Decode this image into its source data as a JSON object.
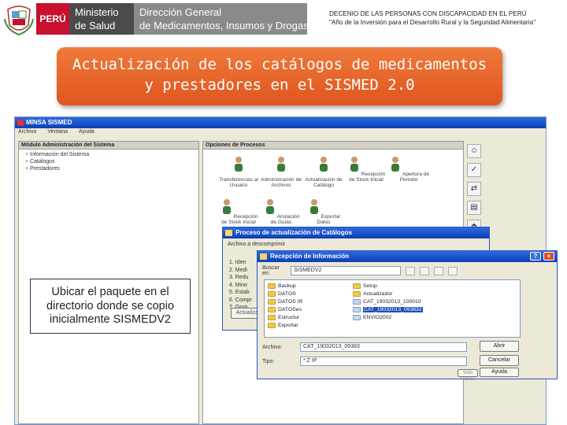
{
  "header": {
    "peru_label": "PERÚ",
    "ministry_line1": "Ministerio",
    "ministry_line2": "de Salud",
    "directorate_line1": "Dirección General",
    "directorate_line2": "de Medicamentos, Insumos y Drogas",
    "decenio_line1": "DECENIO DE LAS PERSONAS CON DISCAPACIDAD EN EL PERÚ",
    "decenio_line2": "\"Año de la Inversión para el Desarrollo Rural y la Seguridad Alimentaria\""
  },
  "banner": {
    "line1": "Actualización de los catálogos de medicamentos",
    "line2": "y prestadores en el SISMED 2.0",
    "color": "#e8622a"
  },
  "app": {
    "title": "MINSA SISMED",
    "menu": [
      "Archivo",
      "Ventana",
      "Ayuda"
    ],
    "module_header": "Módulo Administración del Sistema",
    "tree": [
      "Información del Sistema",
      "Catálogos",
      "Prestadores"
    ],
    "options_header": "Opciones de Procesos",
    "options": [
      "Transferencias al Usuario",
      "Administración de Archivos",
      "Actualización de Catálogo",
      "Recepción de Stock Inicial",
      "Apertura de Periodo",
      "Recepción de Stock Inicial",
      "Anulación de Guías",
      "Exportar Datos"
    ],
    "toolbar_icons": [
      "people-icon",
      "check-icon",
      "network-icon",
      "document-icon",
      "exit-icon"
    ]
  },
  "dialog_catalog": {
    "title": "Proceso de actualización de Catálogos",
    "subtitle": "Archivo a descomprimir",
    "steps": [
      "1. Iden",
      "2. Medi",
      "3. Redu",
      "4. Mino",
      "5. Estab",
      "6. Compr",
      "7. Grup"
    ],
    "button": "Actualizar"
  },
  "dialog_receive": {
    "title": "Recepción de Información",
    "look_in_label": "Buscar en:",
    "look_in_value": "SISMEDV2",
    "folders_col1": [
      "Backup",
      "DATOS",
      "DATOS IR",
      "DATOSes",
      "Estructur",
      "Exportar"
    ],
    "folders_col2": [
      "Setup",
      "Actualizador",
      "CAT_19032013_100010",
      "CAT_19032013_093832",
      "ENVIO2002"
    ],
    "selected_item": "CAT_19032013_093832",
    "file_label": "Archivo:",
    "file_value": "CAT_19032013_09383",
    "type_label": "Tipo:",
    "type_value": "*.Z IP",
    "open_button": "Abrir",
    "cancel_button": "Cancelar",
    "help_button": "Ayuda",
    "readonly_button": "Solo lectura"
  },
  "note": {
    "text": "Ubicar el paquete en el directorio donde se copio inicialmente SISMEDV2"
  }
}
